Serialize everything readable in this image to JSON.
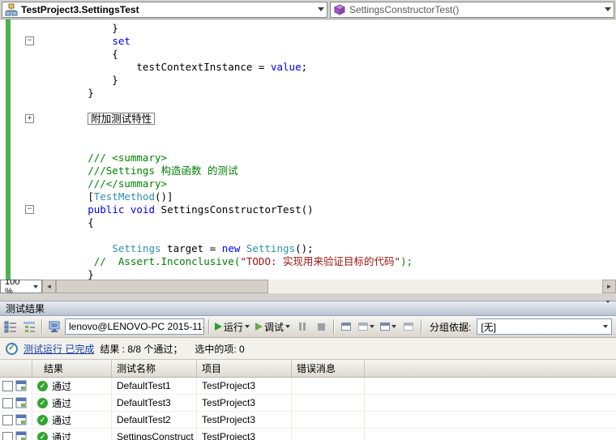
{
  "navbar": {
    "type_selector": "TestProject3.SettingsTest",
    "member_selector": "SettingsConstructorTest()"
  },
  "editor": {
    "zoom_level": "100 %",
    "collapsed_region_label": "附加测试特性",
    "lines": [
      [
        {
          "t": "            }",
          "c": "p"
        }
      ],
      [
        {
          "t": "            ",
          "c": "p"
        },
        {
          "t": "set",
          "c": "k"
        }
      ],
      [
        {
          "t": "            {",
          "c": "p"
        }
      ],
      [
        {
          "t": "                testContextInstance = ",
          "c": "p"
        },
        {
          "t": "value",
          "c": "k"
        },
        {
          "t": ";",
          "c": "p"
        }
      ],
      [
        {
          "t": "            }",
          "c": "p"
        }
      ],
      [
        {
          "t": "        }",
          "c": "p"
        }
      ],
      [],
      [
        {
          "t": "        ",
          "c": "p"
        },
        {
          "t": "附加测试特性",
          "c": "box"
        }
      ],
      [],
      [],
      [
        {
          "t": "        /// <summary>",
          "c": "c"
        }
      ],
      [
        {
          "t": "        ///Settings 构造函数 的测试",
          "c": "c"
        }
      ],
      [
        {
          "t": "        ///</summary>",
          "c": "c"
        }
      ],
      [
        {
          "t": "        [",
          "c": "p"
        },
        {
          "t": "TestMethod",
          "c": "t"
        },
        {
          "t": "()]",
          "c": "p"
        }
      ],
      [
        {
          "t": "        ",
          "c": "p"
        },
        {
          "t": "public",
          "c": "k"
        },
        {
          "t": " ",
          "c": "p"
        },
        {
          "t": "void",
          "c": "k"
        },
        {
          "t": " SettingsConstructorTest()",
          "c": "p"
        }
      ],
      [
        {
          "t": "        {",
          "c": "p"
        }
      ],
      [],
      [
        {
          "t": "            ",
          "c": "p"
        },
        {
          "t": "Settings",
          "c": "t"
        },
        {
          "t": " target = ",
          "c": "p"
        },
        {
          "t": "new",
          "c": "k"
        },
        {
          "t": " ",
          "c": "p"
        },
        {
          "t": "Settings",
          "c": "t"
        },
        {
          "t": "();",
          "c": "p"
        }
      ],
      [
        {
          "t": "         //  Assert.Inconclusive(",
          "c": "c"
        },
        {
          "t": "\"TODO: 实现用来验证目标的代码\"",
          "c": "s"
        },
        {
          "t": ");",
          "c": "c"
        }
      ],
      [
        {
          "t": "        }",
          "c": "p"
        }
      ]
    ],
    "fold_markers": [
      {
        "line": 1,
        "glyph": "−"
      },
      {
        "line": 7,
        "glyph": "+"
      },
      {
        "line": 14,
        "glyph": "−"
      }
    ]
  },
  "test_results": {
    "title": "测试结果",
    "toolbar": {
      "target_combo_value": "lenovo@LENOVO-PC 2015-11-",
      "run_label": "运行",
      "debug_label": "调试",
      "group_by_label": "分组依据:",
      "group_by_value": "[无]"
    },
    "status": {
      "link_text": "测试运行 已完成",
      "results_text": "结果 : 8/8 个通过；",
      "selected_text": "选中的项: 0"
    },
    "table": {
      "headers": [
        "结果",
        "测试名称",
        "项目",
        "错误消息"
      ],
      "rows": [
        {
          "result": "通过",
          "name": "DefaultTest1",
          "project": "TestProject3",
          "error": ""
        },
        {
          "result": "通过",
          "name": "DefaultTest3",
          "project": "TestProject3",
          "error": ""
        },
        {
          "result": "通过",
          "name": "DefaultTest2",
          "project": "TestProject3",
          "error": ""
        },
        {
          "result": "通过",
          "name": "SettingsConstruct",
          "project": "TestProject3",
          "error": ""
        }
      ]
    }
  },
  "colors": {
    "keyword": "#0000ff",
    "type": "#2b91af",
    "comment": "#008000",
    "string": "#a31515",
    "change_bar": "#4db14d",
    "pass_green": "#2fa52f",
    "link_blue": "#1840a5"
  }
}
